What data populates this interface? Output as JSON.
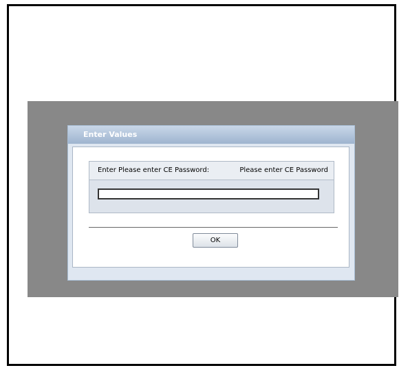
{
  "dialog": {
    "title": "Enter Values",
    "field": {
      "label": "Enter Please enter CE Password:",
      "hint": "Please enter CE Password",
      "value": "",
      "placeholder": ""
    },
    "ok_label": "OK"
  },
  "colors": {
    "overlay": "#888888",
    "titlebar": "#9eb4cf",
    "dialog_bg": "#dfe7f1"
  }
}
